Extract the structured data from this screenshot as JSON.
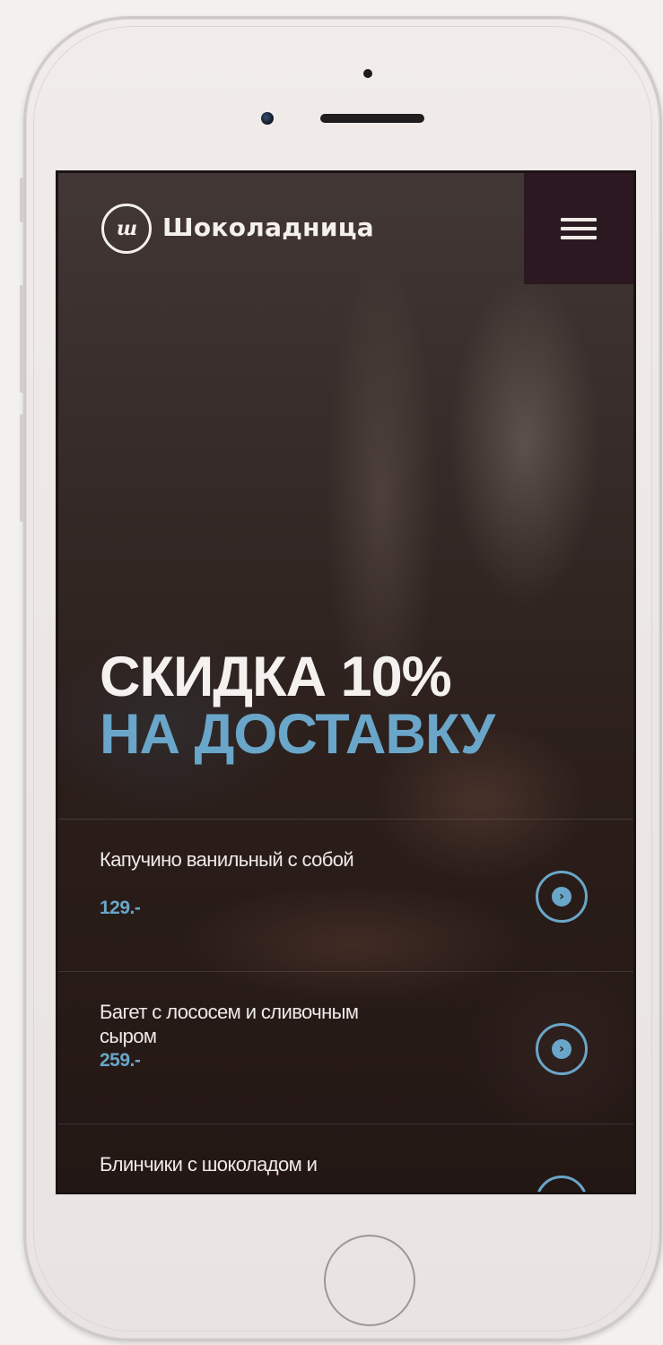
{
  "header": {
    "logo_glyph": "ш",
    "brand_name": "Шоколадница"
  },
  "hero": {
    "line1": "СКИДКА 10%",
    "line2": "НА ДОСТАВКУ"
  },
  "products": [
    {
      "name": "Капучино ванильный с собой",
      "price": "129.-"
    },
    {
      "name": "Багет с лососем и сливочным сыром",
      "price": "259.-"
    },
    {
      "name": "Блинчики с шоколадом и",
      "price": ""
    }
  ],
  "icons": {
    "menu": "hamburger-icon",
    "product_arrow": "chevron-right-icon"
  },
  "colors": {
    "accent": "#6aa6c9",
    "menu_bg": "#2b1820",
    "text_light": "#f5f1ee"
  }
}
